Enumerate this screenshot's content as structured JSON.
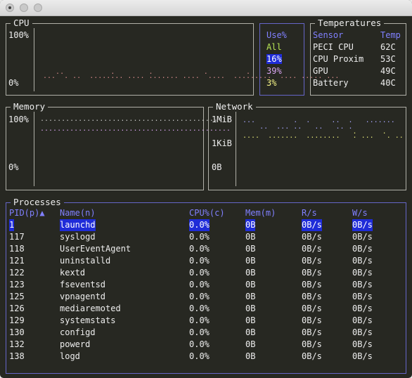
{
  "cpu": {
    "title": "CPU",
    "max_label": "100%",
    "min_label": "0%",
    "use_header": "Use%",
    "rows": [
      {
        "label": "All",
        "color": "#b6e354"
      },
      {
        "label": "16%",
        "color": "#ffffff",
        "highlight": "#1f2cd8"
      },
      {
        "label": "39%",
        "color": "#d7a4f0"
      },
      {
        "label": "3%",
        "color": "#f4f286"
      }
    ],
    "line_color": "#d98c8c"
  },
  "temperatures": {
    "title": "Temperatures",
    "headers": {
      "sensor": "Sensor",
      "temp": "Temp"
    },
    "rows": [
      {
        "sensor": "PECI CPU",
        "temp": "62C"
      },
      {
        "sensor": "CPU Proxim",
        "temp": "53C"
      },
      {
        "sensor": "GPU",
        "temp": "49C"
      },
      {
        "sensor": "Battery",
        "temp": "40C"
      }
    ]
  },
  "memory": {
    "title": "Memory",
    "max_label": "100%",
    "min_label": "0%",
    "colors": [
      "#c8c8c8",
      "#d7a4f0"
    ]
  },
  "network": {
    "title": "Network",
    "top_label": "1MiB",
    "mid_label": "1KiB",
    "bottom_label": "0B",
    "colors": [
      "#a8a8ff",
      "#e8e87a"
    ]
  },
  "processes": {
    "title": "Processes",
    "headers": {
      "pid": "PID(p)▲",
      "name": "Name(n)",
      "cpu": "CPU%(c)",
      "mem": "Mem(m)",
      "r": "R/s",
      "w": "W/s"
    },
    "rows": [
      {
        "pid": "1",
        "name": "launchd",
        "cpu": "0.0%",
        "mem": "0B",
        "r": "0B/s",
        "w": "0B/s"
      },
      {
        "pid": "117",
        "name": "syslogd",
        "cpu": "0.0%",
        "mem": "0B",
        "r": "0B/s",
        "w": "0B/s"
      },
      {
        "pid": "118",
        "name": "UserEventAgent",
        "cpu": "0.0%",
        "mem": "0B",
        "r": "0B/s",
        "w": "0B/s"
      },
      {
        "pid": "121",
        "name": "uninstalld",
        "cpu": "0.0%",
        "mem": "0B",
        "r": "0B/s",
        "w": "0B/s"
      },
      {
        "pid": "122",
        "name": "kextd",
        "cpu": "0.0%",
        "mem": "0B",
        "r": "0B/s",
        "w": "0B/s"
      },
      {
        "pid": "123",
        "name": "fseventsd",
        "cpu": "0.0%",
        "mem": "0B",
        "r": "0B/s",
        "w": "0B/s"
      },
      {
        "pid": "125",
        "name": "vpnagentd",
        "cpu": "0.0%",
        "mem": "0B",
        "r": "0B/s",
        "w": "0B/s"
      },
      {
        "pid": "126",
        "name": "mediaremoted",
        "cpu": "0.0%",
        "mem": "0B",
        "r": "0B/s",
        "w": "0B/s"
      },
      {
        "pid": "129",
        "name": "systemstats",
        "cpu": "0.0%",
        "mem": "0B",
        "r": "0B/s",
        "w": "0B/s"
      },
      {
        "pid": "130",
        "name": "configd",
        "cpu": "0.0%",
        "mem": "0B",
        "r": "0B/s",
        "w": "0B/s"
      },
      {
        "pid": "132",
        "name": "powerd",
        "cpu": "0.0%",
        "mem": "0B",
        "r": "0B/s",
        "w": "0B/s"
      },
      {
        "pid": "138",
        "name": "logd",
        "cpu": "0.0%",
        "mem": "0B",
        "r": "0B/s",
        "w": "0B/s"
      }
    ]
  }
}
